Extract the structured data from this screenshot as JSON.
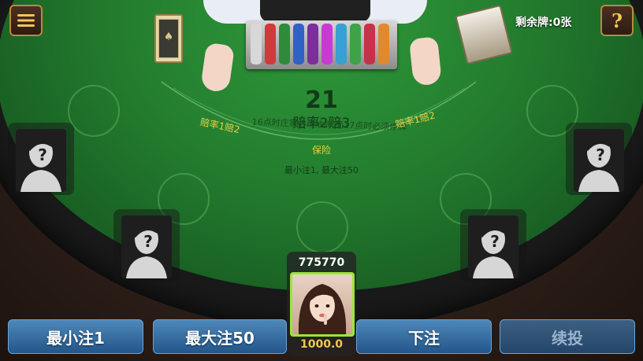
{
  "cards_remaining": "剩余牌:0张",
  "table": {
    "dealer_count": "21",
    "payout": "赔率2赔3",
    "left_side_payout": "赔率1赔2",
    "right_side_payout": "赔率1赔2",
    "rule": "16点时庄家必须抽牌,而17点时必须停牌",
    "insurance": "保险",
    "limits": "最小注1, 最大注50"
  },
  "player": {
    "score": "775770",
    "money": "1000.0"
  },
  "buttons": {
    "min_bet": "最小注1",
    "max_bet": "最大注50",
    "place_bet": "下注",
    "repeat_bet": "续投"
  },
  "help_label": "?",
  "deck_symbol": "♠"
}
